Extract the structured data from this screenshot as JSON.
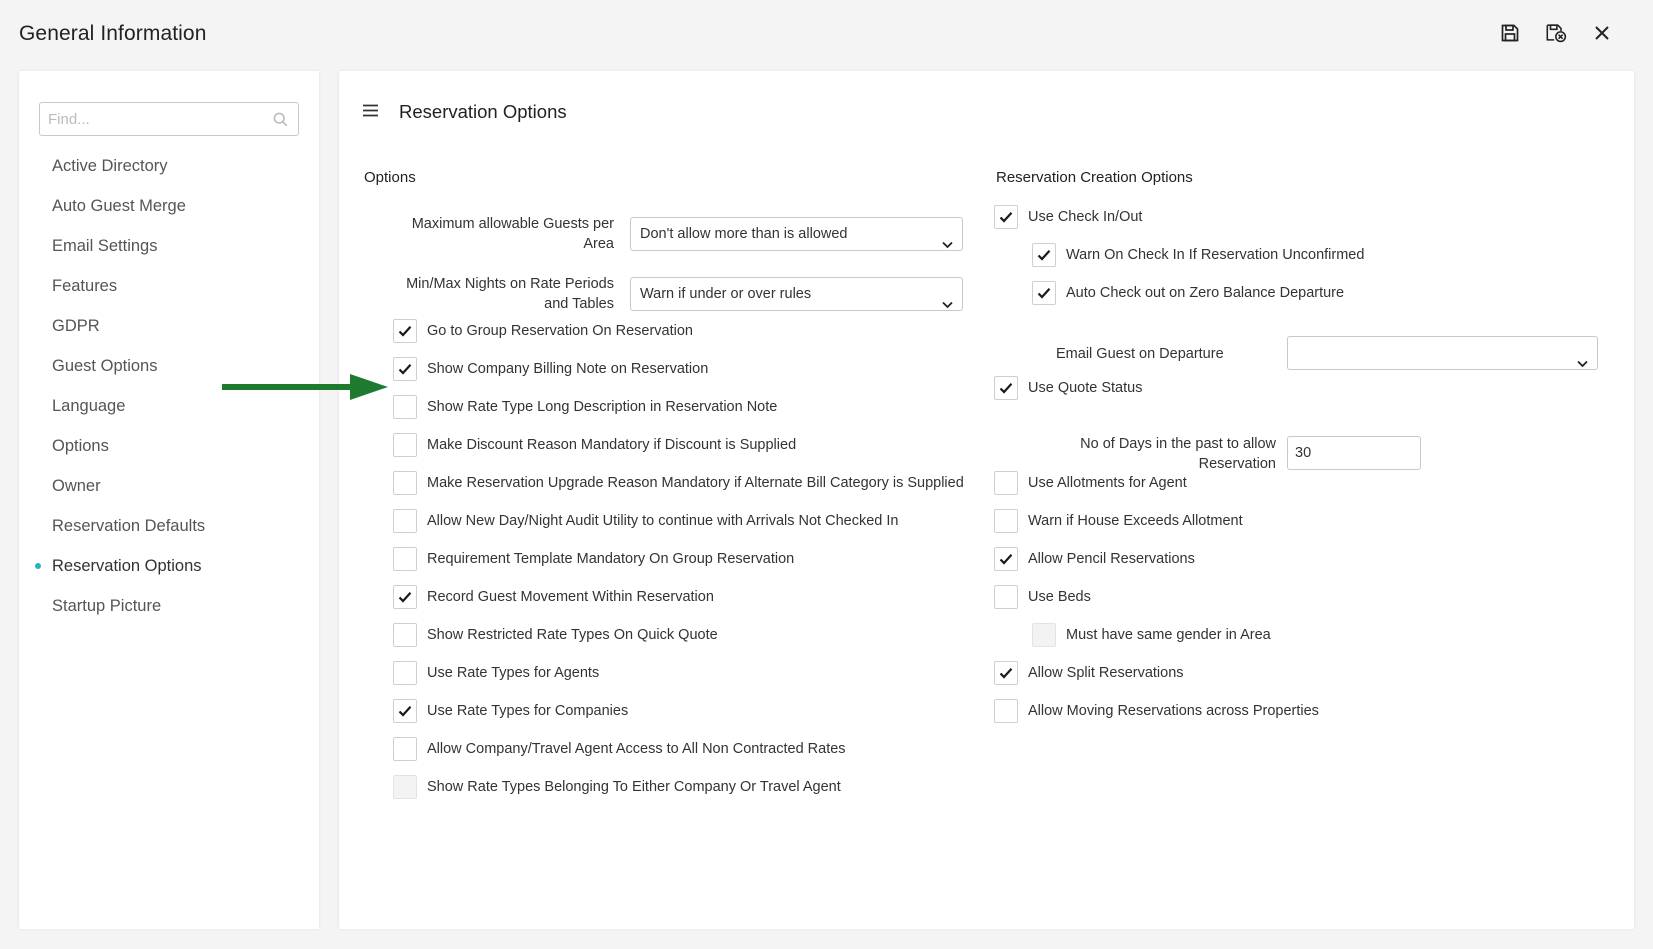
{
  "window": {
    "title": "General Information"
  },
  "toolbar": [
    {
      "name": "save-icon",
      "label": "Save"
    },
    {
      "name": "save-close-icon",
      "label": "Save and Close"
    },
    {
      "name": "close-icon",
      "label": "Close"
    }
  ],
  "sidebar": {
    "search_placeholder": "Find...",
    "items": [
      {
        "label": "Active Directory",
        "active": false
      },
      {
        "label": "Auto Guest Merge",
        "active": false
      },
      {
        "label": "Email Settings",
        "active": false
      },
      {
        "label": "Features",
        "active": false
      },
      {
        "label": "GDPR",
        "active": false
      },
      {
        "label": "Guest Options",
        "active": false
      },
      {
        "label": "Language",
        "active": false
      },
      {
        "label": "Options",
        "active": false
      },
      {
        "label": "Owner",
        "active": false
      },
      {
        "label": "Reservation Defaults",
        "active": false
      },
      {
        "label": "Reservation Options",
        "active": true
      },
      {
        "label": "Startup Picture",
        "active": false
      }
    ]
  },
  "main": {
    "title": "Reservation Options",
    "options": {
      "heading": "Options",
      "max_guests_label": "Maximum allowable Guests per Area",
      "max_guests_value": "Don't allow more than is allowed",
      "min_max_label": "Min/Max Nights on Rate Periods and Tables",
      "min_max_value": "Warn if under or over rules",
      "checkboxes": [
        {
          "label": "Go to Group Reservation On Reservation",
          "checked": true,
          "disabled": false
        },
        {
          "label": "Show Company Billing Note on Reservation",
          "checked": true,
          "disabled": false
        },
        {
          "label": "Show Rate Type Long Description in Reservation Note",
          "checked": false,
          "disabled": false
        },
        {
          "label": "Make Discount Reason Mandatory if Discount is Supplied",
          "checked": false,
          "disabled": false
        },
        {
          "label": "Make Reservation Upgrade Reason Mandatory if Alternate Bill Category is Supplied",
          "checked": false,
          "disabled": false
        },
        {
          "label": "Allow New Day/Night Audit Utility to continue with Arrivals Not Checked In",
          "checked": false,
          "disabled": false
        },
        {
          "label": "Requirement Template Mandatory On Group Reservation",
          "checked": false,
          "disabled": false
        },
        {
          "label": "Record Guest Movement Within Reservation",
          "checked": true,
          "disabled": false
        },
        {
          "label": "Show Restricted Rate Types On Quick Quote",
          "checked": false,
          "disabled": false
        },
        {
          "label": "Use Rate Types for Agents",
          "checked": false,
          "disabled": false
        },
        {
          "label": "Use Rate Types for Companies",
          "checked": true,
          "disabled": false
        },
        {
          "label": "Allow Company/Travel Agent Access to All Non Contracted Rates",
          "checked": false,
          "disabled": false
        },
        {
          "label": "Show Rate Types Belonging To Either Company Or Travel Agent",
          "checked": false,
          "disabled": true
        }
      ]
    },
    "creation": {
      "heading": "Reservation Creation Options",
      "use_check_in_out": {
        "label": "Use Check In/Out",
        "checked": true
      },
      "warn_check_in": {
        "label": "Warn On Check In If Reservation Unconfirmed",
        "checked": true
      },
      "auto_check_out": {
        "label": "Auto Check out on Zero Balance Departure",
        "checked": true
      },
      "email_guest_label": "Email Guest on Departure",
      "email_guest_value": "",
      "use_quote_status": {
        "label": "Use Quote Status",
        "checked": true
      },
      "days_past_label": "No of Days in the past to allow Reservation",
      "days_past_value": "30",
      "use_allotments": {
        "label": "Use Allotments for Agent",
        "checked": false
      },
      "warn_house": {
        "label": "Warn if House Exceeds Allotment",
        "checked": false
      },
      "allow_pencil": {
        "label": "Allow Pencil Reservations",
        "checked": true
      },
      "use_beds": {
        "label": "Use Beds",
        "checked": false
      },
      "same_gender": {
        "label": "Must have same gender in Area",
        "checked": false,
        "disabled": true
      },
      "allow_split": {
        "label": "Allow Split Reservations",
        "checked": true
      },
      "allow_moving": {
        "label": "Allow Moving Reservations across Properties",
        "checked": false
      }
    }
  },
  "colors": {
    "accent": "#2bb3c0",
    "arrow": "#1e7a2f"
  }
}
